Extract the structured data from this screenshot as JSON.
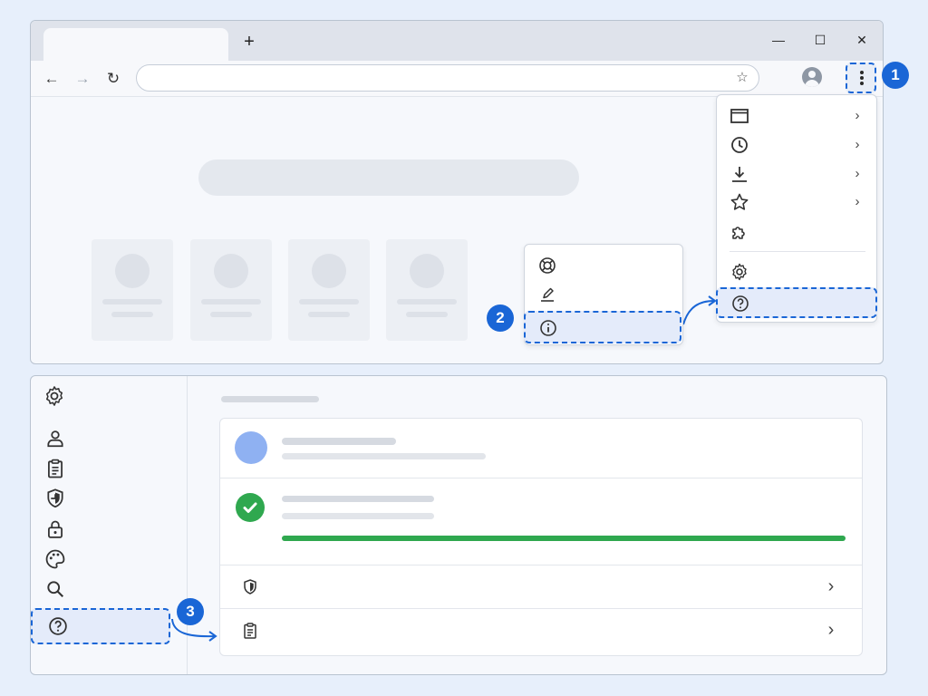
{
  "browser": {
    "new_tab_glyph": "+",
    "window_controls": {
      "minimize": "—",
      "maximize": "☐",
      "close": "✕"
    },
    "nav": {
      "back": "←",
      "forward": "→",
      "reload": "↻"
    },
    "omnibox": {
      "value": "",
      "bookmark_icon": "star-icon"
    },
    "menu_button_icon": "three-dots-vertical-icon"
  },
  "main_menu": {
    "items": [
      {
        "icon": "window-icon",
        "has_submenu": true
      },
      {
        "icon": "history-icon",
        "has_submenu": true
      },
      {
        "icon": "download-icon",
        "has_submenu": true
      },
      {
        "icon": "star-icon",
        "has_submenu": true
      },
      {
        "icon": "extensions-icon",
        "has_submenu": false
      },
      {
        "icon": "gear-icon",
        "has_submenu": false
      },
      {
        "icon": "help-icon",
        "has_submenu": false,
        "highlighted": true
      }
    ]
  },
  "help_submenu": {
    "items": [
      {
        "icon": "lifebuoy-icon"
      },
      {
        "icon": "edit-icon"
      },
      {
        "icon": "info-icon",
        "highlighted": true
      }
    ]
  },
  "steps": {
    "one": "1",
    "two": "2",
    "three": "3"
  },
  "settings": {
    "sidebar_items": [
      "gear-icon",
      "person-icon",
      "clipboard-icon",
      "shield-icon",
      "lock-icon",
      "palette-icon",
      "search-icon",
      "help-icon"
    ],
    "update_progress": 1.0,
    "status_icon": "check-circle-icon",
    "rows": [
      {
        "icon": "shield-icon"
      },
      {
        "icon": "clipboard-icon"
      }
    ]
  },
  "colors": {
    "accent": "#1a66d6",
    "success": "#2fa84f",
    "avatar_blue": "#8fb1f2"
  }
}
